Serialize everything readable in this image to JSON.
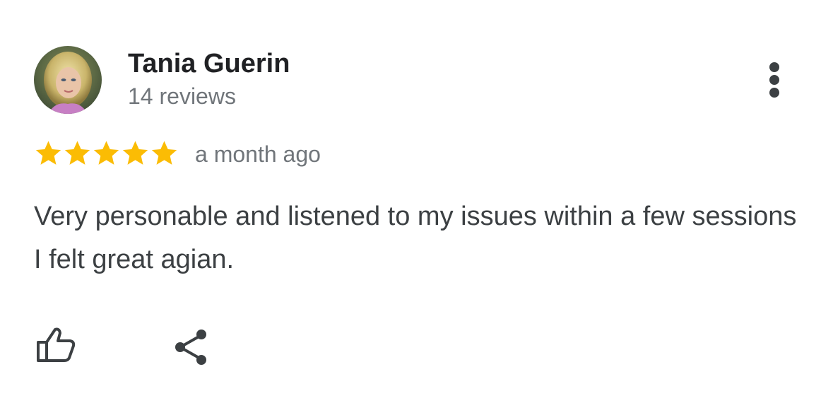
{
  "reviewer": {
    "name": "Tania Guerin",
    "review_count": "14 reviews",
    "avatar_icon": "profile-photo"
  },
  "rating": {
    "stars": 5,
    "max_stars": 5,
    "star_color": "#fbbc04",
    "time": "a month ago"
  },
  "review": {
    "text": "Very personable and listened to my issues within a few sessions I felt great agian."
  },
  "actions": {
    "more_icon": "more-vert-icon",
    "like_icon": "thumb-up-icon",
    "share_icon": "share-icon"
  },
  "colors": {
    "name": "#202124",
    "secondary": "#70757a",
    "body": "#3c4043",
    "icon": "#3c4043"
  }
}
